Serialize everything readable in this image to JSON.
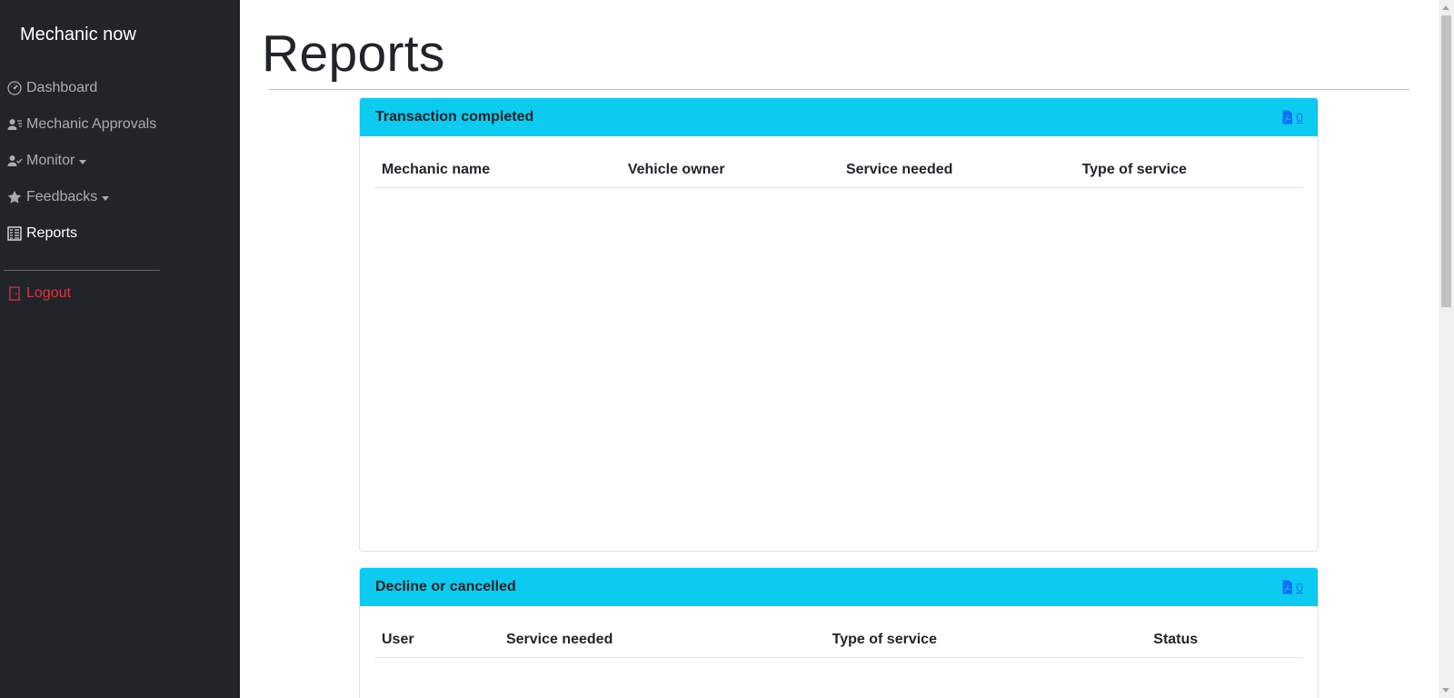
{
  "sidebar": {
    "brand": "Mechanic now",
    "items": [
      {
        "label": "Dashboard",
        "icon": "speedometer-icon"
      },
      {
        "label": "Mechanic Approvals",
        "icon": "person-lines-icon"
      },
      {
        "label": "Monitor",
        "icon": "person-check-icon",
        "dropdown": true
      },
      {
        "label": "Feedbacks",
        "icon": "star-icon",
        "dropdown": true
      },
      {
        "label": "Reports",
        "icon": "report-icon",
        "active": true
      }
    ],
    "logout": "Logout"
  },
  "page": {
    "title": "Reports"
  },
  "cards": [
    {
      "title": "Transaction completed",
      "pdf_count": "0",
      "columns": [
        "Mechanic name",
        "Vehicle owner",
        "Service needed",
        "Type of service"
      ],
      "rows": []
    },
    {
      "title": "Decline or cancelled",
      "pdf_count": "0",
      "columns": [
        "User",
        "Service needed",
        "Type of service",
        "Status"
      ],
      "rows": []
    }
  ],
  "colors": {
    "sidebar_bg": "#212529",
    "card_header": "#0dcaf0",
    "link": "#0d6efd",
    "logout": "#dc3545"
  }
}
